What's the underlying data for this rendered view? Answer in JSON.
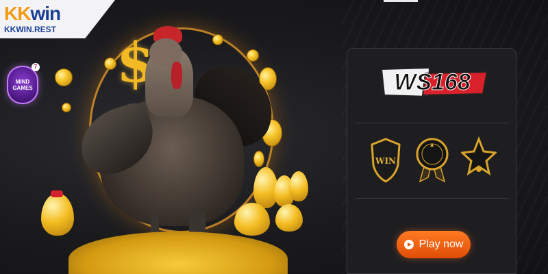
{
  "brand": {
    "name_part1": "KK",
    "name_part2": "win",
    "domain": "KKWIN.REST"
  },
  "mind_badge": {
    "line1": "MIND",
    "line2": "GAMES",
    "count": "7"
  },
  "panel": {
    "logo_text": "WS168",
    "badges": [
      {
        "icon": "win-shield-icon",
        "label": "WIN"
      },
      {
        "icon": "guarantee-medal-icon",
        "label": ""
      },
      {
        "icon": "star-award-icon",
        "label": ""
      }
    ],
    "play_label": "Play now"
  },
  "colors": {
    "brand_orange": "#f39a14",
    "brand_blue": "#1a3f95",
    "accent_orange": "#ff7a22",
    "panel_bg": "#1e1e21",
    "gold": "#f2b925"
  }
}
